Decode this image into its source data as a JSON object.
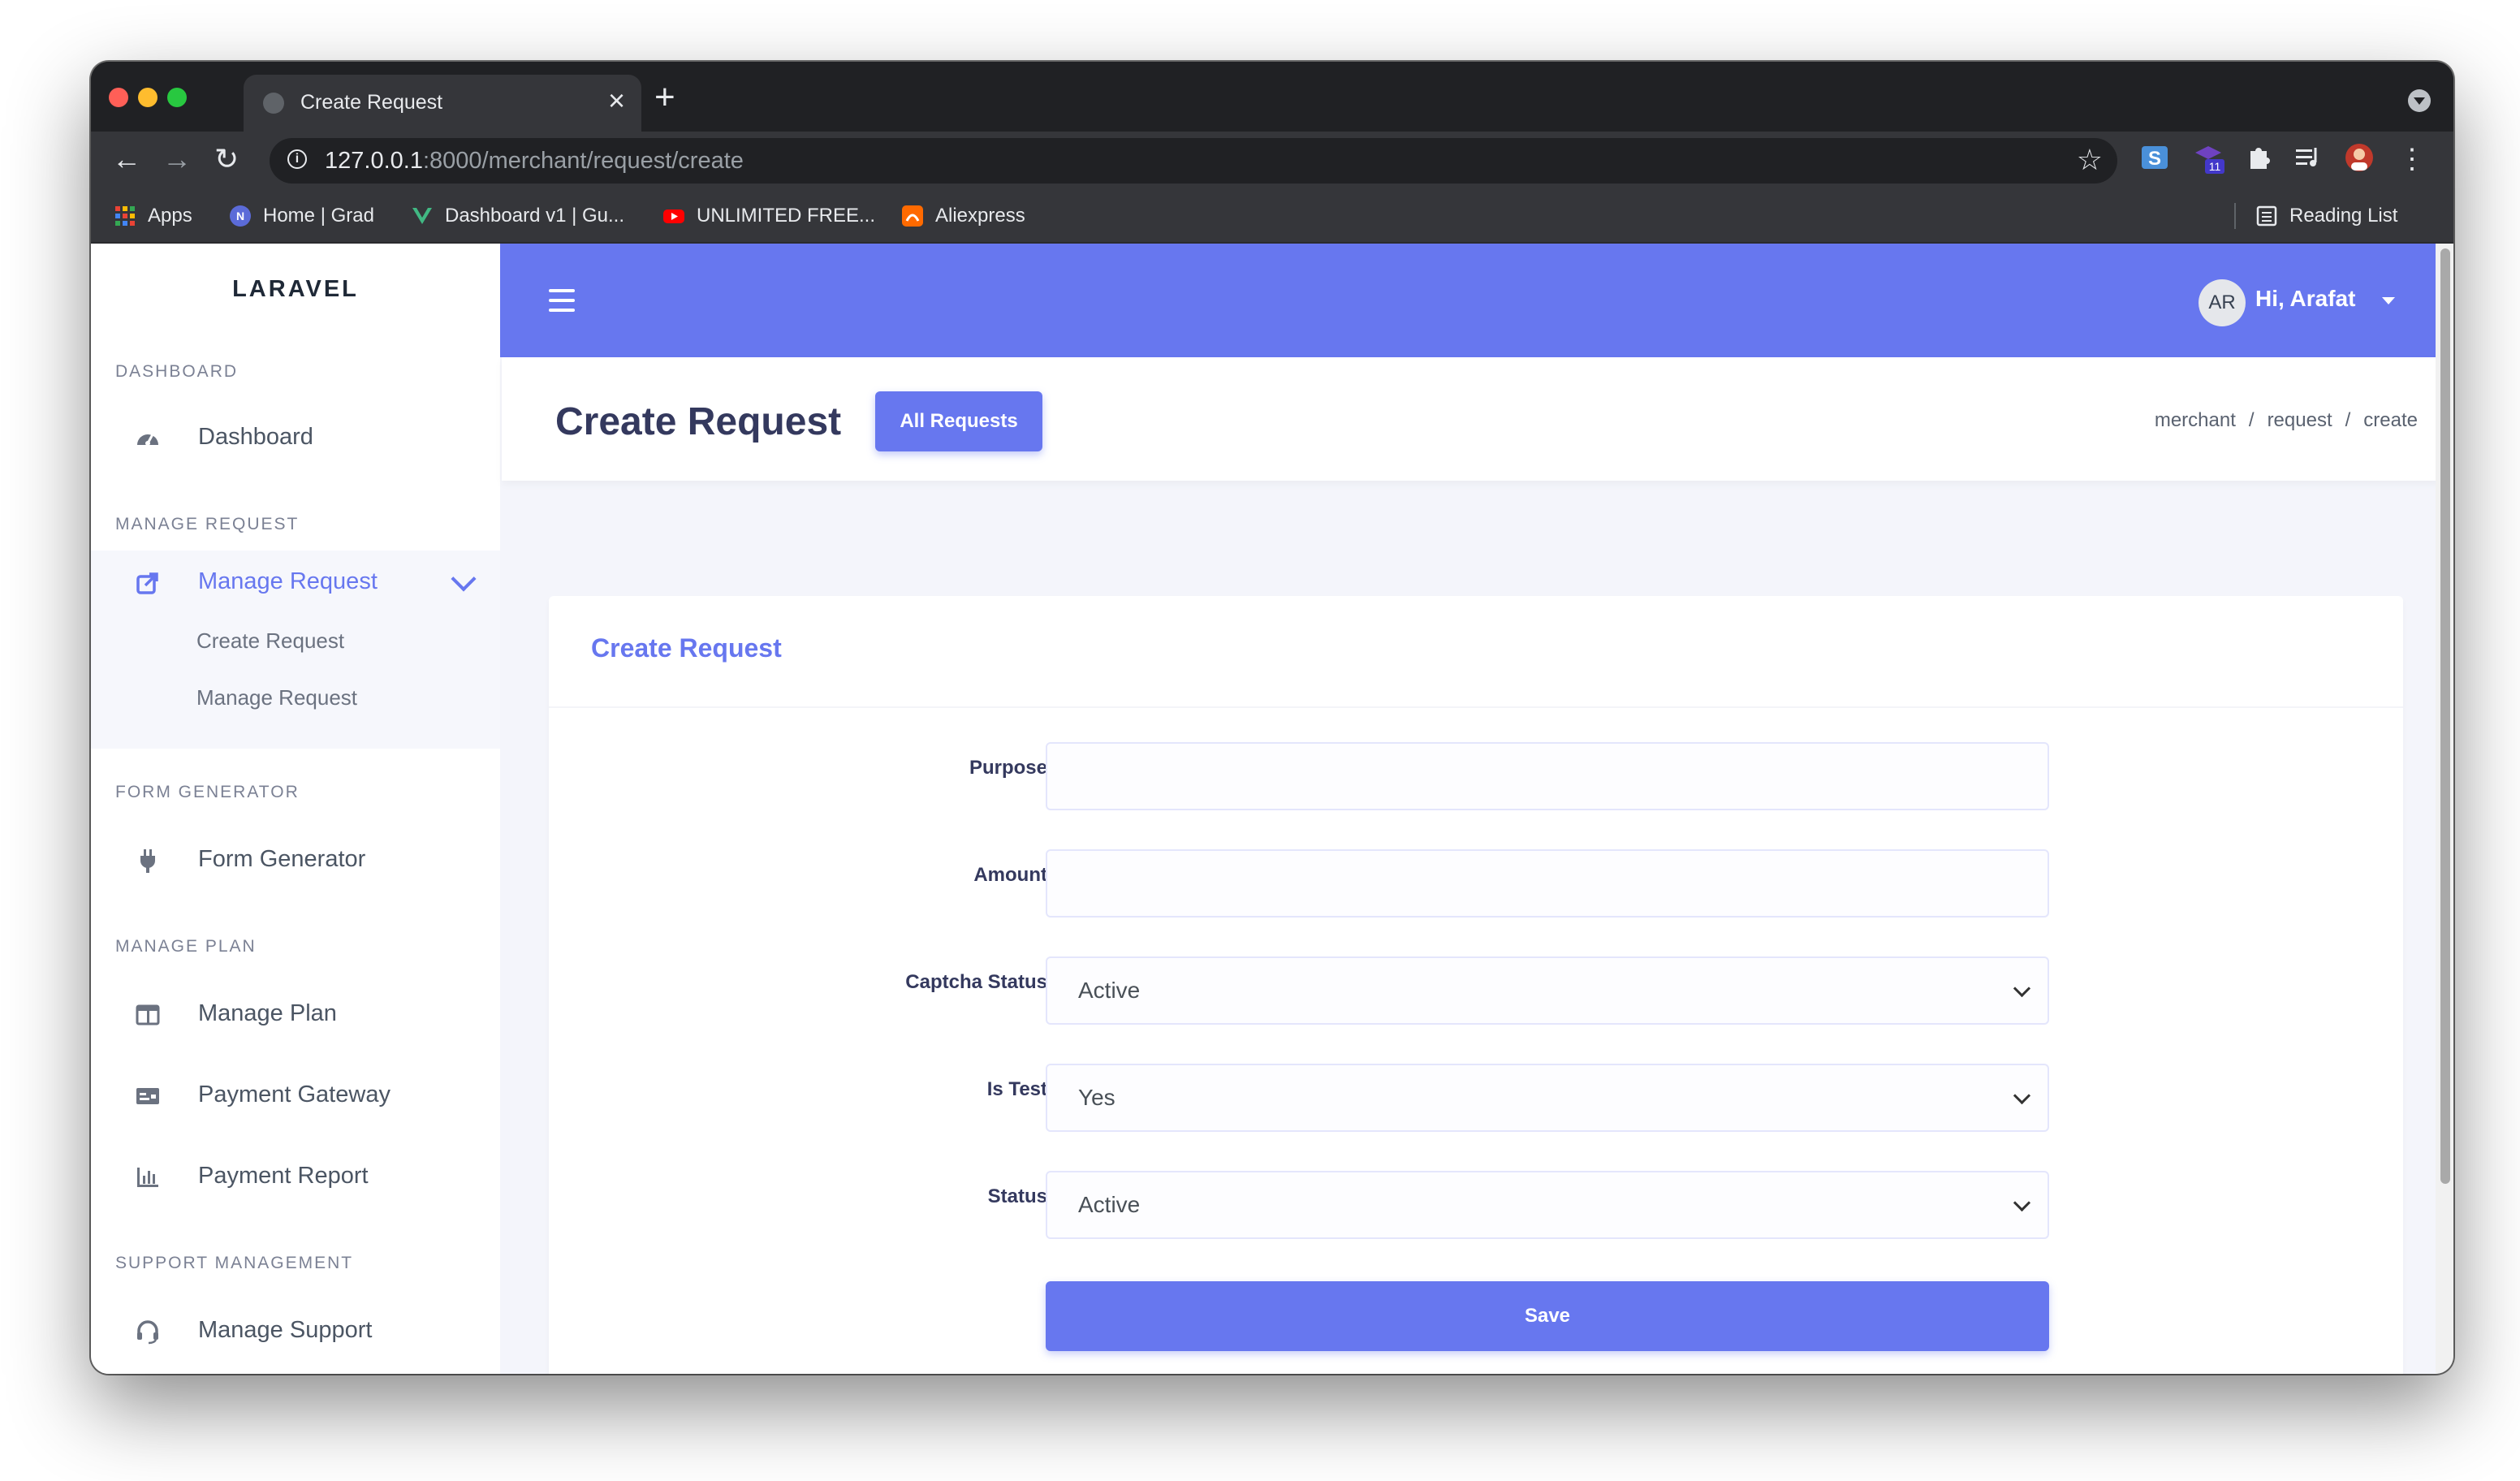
{
  "browser": {
    "tab_title": "Create Request",
    "url_host": "127.0.0.1",
    "url_path": ":8000/merchant/request/create",
    "bookmarks": [
      {
        "label": "Apps",
        "icon": "apps-grid-icon"
      },
      {
        "label": "Home | Grad",
        "icon": "n-logo-icon"
      },
      {
        "label": "Dashboard v1 | Gu...",
        "icon": "vue-logo-icon"
      },
      {
        "label": "UNLIMITED FREE...",
        "icon": "youtube-icon"
      },
      {
        "label": "Aliexpress",
        "icon": "aliexpress-icon"
      }
    ],
    "reading_list": "Reading List",
    "extension_badge": "11"
  },
  "sidebar": {
    "brand": "LARAVEL",
    "sections": [
      {
        "heading": "DASHBOARD",
        "items": [
          {
            "label": "Dashboard",
            "icon": "dashboard-gauge-icon"
          }
        ]
      },
      {
        "heading": "MANAGE REQUEST",
        "items": [
          {
            "label": "Manage Request",
            "icon": "external-link-icon",
            "active": true,
            "children": [
              "Create Request",
              "Manage Request"
            ]
          }
        ]
      },
      {
        "heading": "FORM GENERATOR",
        "items": [
          {
            "label": "Form Generator",
            "icon": "plug-icon"
          }
        ]
      },
      {
        "heading": "MANAGE PLAN",
        "items": [
          {
            "label": "Manage Plan",
            "icon": "columns-icon"
          },
          {
            "label": "Payment Gateway",
            "icon": "money-check-icon"
          },
          {
            "label": "Payment Report",
            "icon": "bar-chart-icon"
          }
        ]
      },
      {
        "heading": "SUPPORT MANAGEMENT",
        "items": [
          {
            "label": "Manage Support",
            "icon": "headset-icon"
          }
        ]
      }
    ]
  },
  "navbar": {
    "avatar_initials": "AR",
    "greeting": "Hi, Arafat"
  },
  "header": {
    "title": "Create Request",
    "all_requests_button": "All Requests",
    "breadcrumb": [
      "merchant",
      "request",
      "create"
    ]
  },
  "form": {
    "card_title": "Create Request",
    "fields": [
      {
        "label": "Purpose",
        "type": "text",
        "value": ""
      },
      {
        "label": "Amount",
        "type": "text",
        "value": ""
      },
      {
        "label": "Captcha Status",
        "type": "select",
        "value": "Active"
      },
      {
        "label": "Is Test",
        "type": "select",
        "value": "Yes"
      },
      {
        "label": "Status",
        "type": "select",
        "value": "Active"
      }
    ],
    "save_button": "Save"
  },
  "colors": {
    "primary": "#6777ef",
    "page_bg": "#f4f5fb",
    "browser_dark": "#202124"
  }
}
